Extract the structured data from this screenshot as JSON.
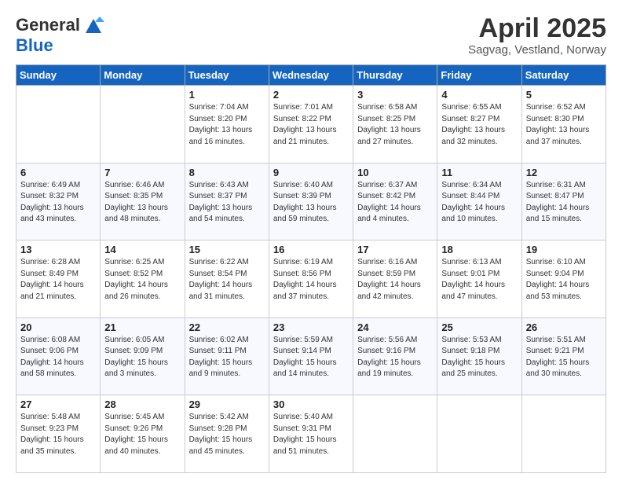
{
  "header": {
    "logo_general": "General",
    "logo_blue": "Blue",
    "month_title": "April 2025",
    "location": "Sagvag, Vestland, Norway"
  },
  "days_of_week": [
    "Sunday",
    "Monday",
    "Tuesday",
    "Wednesday",
    "Thursday",
    "Friday",
    "Saturday"
  ],
  "weeks": [
    [
      {
        "day": "",
        "info": ""
      },
      {
        "day": "",
        "info": ""
      },
      {
        "day": "1",
        "info": "Sunrise: 7:04 AM\nSunset: 8:20 PM\nDaylight: 13 hours and 16 minutes."
      },
      {
        "day": "2",
        "info": "Sunrise: 7:01 AM\nSunset: 8:22 PM\nDaylight: 13 hours and 21 minutes."
      },
      {
        "day": "3",
        "info": "Sunrise: 6:58 AM\nSunset: 8:25 PM\nDaylight: 13 hours and 27 minutes."
      },
      {
        "day": "4",
        "info": "Sunrise: 6:55 AM\nSunset: 8:27 PM\nDaylight: 13 hours and 32 minutes."
      },
      {
        "day": "5",
        "info": "Sunrise: 6:52 AM\nSunset: 8:30 PM\nDaylight: 13 hours and 37 minutes."
      }
    ],
    [
      {
        "day": "6",
        "info": "Sunrise: 6:49 AM\nSunset: 8:32 PM\nDaylight: 13 hours and 43 minutes."
      },
      {
        "day": "7",
        "info": "Sunrise: 6:46 AM\nSunset: 8:35 PM\nDaylight: 13 hours and 48 minutes."
      },
      {
        "day": "8",
        "info": "Sunrise: 6:43 AM\nSunset: 8:37 PM\nDaylight: 13 hours and 54 minutes."
      },
      {
        "day": "9",
        "info": "Sunrise: 6:40 AM\nSunset: 8:39 PM\nDaylight: 13 hours and 59 minutes."
      },
      {
        "day": "10",
        "info": "Sunrise: 6:37 AM\nSunset: 8:42 PM\nDaylight: 14 hours and 4 minutes."
      },
      {
        "day": "11",
        "info": "Sunrise: 6:34 AM\nSunset: 8:44 PM\nDaylight: 14 hours and 10 minutes."
      },
      {
        "day": "12",
        "info": "Sunrise: 6:31 AM\nSunset: 8:47 PM\nDaylight: 14 hours and 15 minutes."
      }
    ],
    [
      {
        "day": "13",
        "info": "Sunrise: 6:28 AM\nSunset: 8:49 PM\nDaylight: 14 hours and 21 minutes."
      },
      {
        "day": "14",
        "info": "Sunrise: 6:25 AM\nSunset: 8:52 PM\nDaylight: 14 hours and 26 minutes."
      },
      {
        "day": "15",
        "info": "Sunrise: 6:22 AM\nSunset: 8:54 PM\nDaylight: 14 hours and 31 minutes."
      },
      {
        "day": "16",
        "info": "Sunrise: 6:19 AM\nSunset: 8:56 PM\nDaylight: 14 hours and 37 minutes."
      },
      {
        "day": "17",
        "info": "Sunrise: 6:16 AM\nSunset: 8:59 PM\nDaylight: 14 hours and 42 minutes."
      },
      {
        "day": "18",
        "info": "Sunrise: 6:13 AM\nSunset: 9:01 PM\nDaylight: 14 hours and 47 minutes."
      },
      {
        "day": "19",
        "info": "Sunrise: 6:10 AM\nSunset: 9:04 PM\nDaylight: 14 hours and 53 minutes."
      }
    ],
    [
      {
        "day": "20",
        "info": "Sunrise: 6:08 AM\nSunset: 9:06 PM\nDaylight: 14 hours and 58 minutes."
      },
      {
        "day": "21",
        "info": "Sunrise: 6:05 AM\nSunset: 9:09 PM\nDaylight: 15 hours and 3 minutes."
      },
      {
        "day": "22",
        "info": "Sunrise: 6:02 AM\nSunset: 9:11 PM\nDaylight: 15 hours and 9 minutes."
      },
      {
        "day": "23",
        "info": "Sunrise: 5:59 AM\nSunset: 9:14 PM\nDaylight: 15 hours and 14 minutes."
      },
      {
        "day": "24",
        "info": "Sunrise: 5:56 AM\nSunset: 9:16 PM\nDaylight: 15 hours and 19 minutes."
      },
      {
        "day": "25",
        "info": "Sunrise: 5:53 AM\nSunset: 9:18 PM\nDaylight: 15 hours and 25 minutes."
      },
      {
        "day": "26",
        "info": "Sunrise: 5:51 AM\nSunset: 9:21 PM\nDaylight: 15 hours and 30 minutes."
      }
    ],
    [
      {
        "day": "27",
        "info": "Sunrise: 5:48 AM\nSunset: 9:23 PM\nDaylight: 15 hours and 35 minutes."
      },
      {
        "day": "28",
        "info": "Sunrise: 5:45 AM\nSunset: 9:26 PM\nDaylight: 15 hours and 40 minutes."
      },
      {
        "day": "29",
        "info": "Sunrise: 5:42 AM\nSunset: 9:28 PM\nDaylight: 15 hours and 45 minutes."
      },
      {
        "day": "30",
        "info": "Sunrise: 5:40 AM\nSunset: 9:31 PM\nDaylight: 15 hours and 51 minutes."
      },
      {
        "day": "",
        "info": ""
      },
      {
        "day": "",
        "info": ""
      },
      {
        "day": "",
        "info": ""
      }
    ]
  ]
}
